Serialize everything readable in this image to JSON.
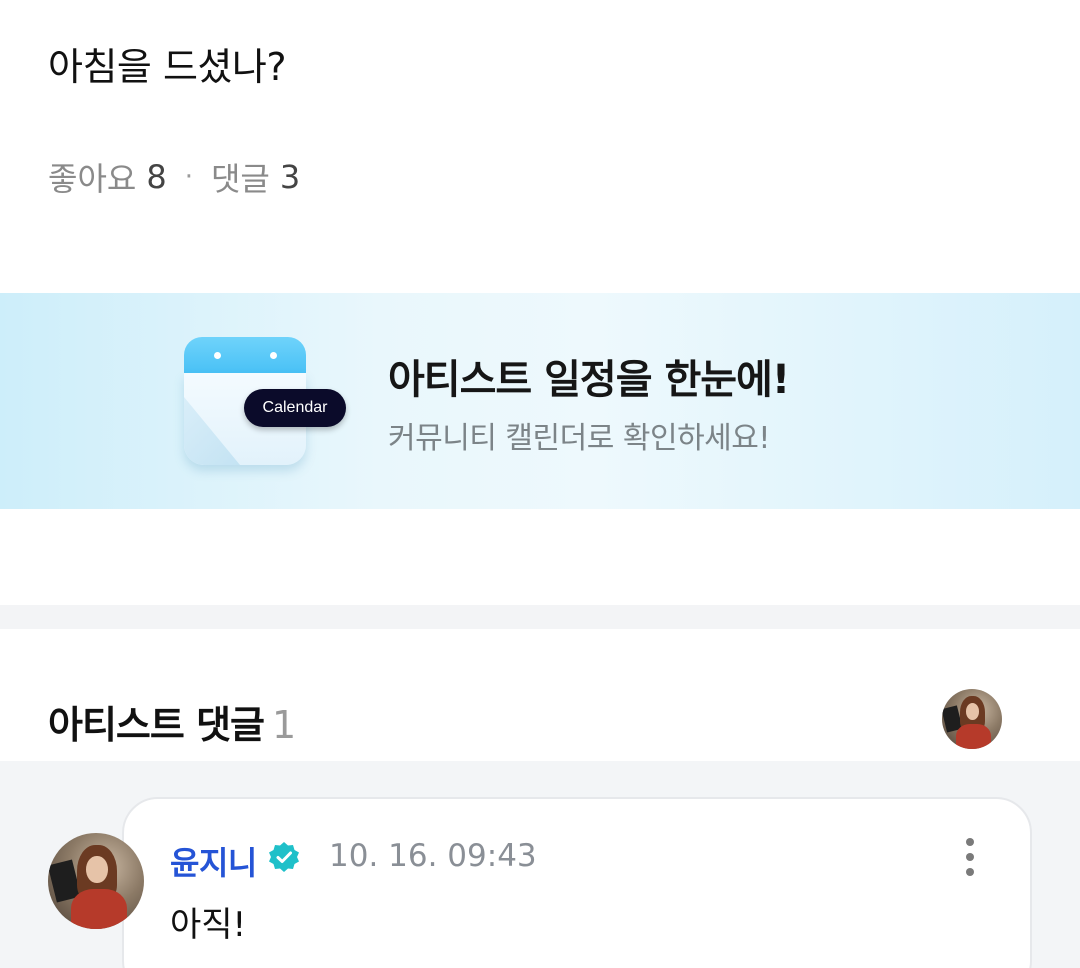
{
  "post": {
    "title": "아침을 드셨나?",
    "likes_label": "좋아요",
    "likes_count": "8",
    "separator": "·",
    "comments_label": "댓글",
    "comments_count": "3"
  },
  "banner": {
    "calendar_label": "Calendar",
    "title": "아티스트 일정을 한눈에!",
    "subtitle": "커뮤니티 캘린더로 확인하세요!"
  },
  "artist_comments": {
    "title": "아티스트 댓글",
    "count": "1"
  },
  "comment": {
    "author": "윤지니",
    "timestamp": "10. 16. 09:43",
    "text": "아직!"
  },
  "icons": {
    "verified": "verified-badge-icon",
    "more": "more-vertical-icon",
    "calendar": "calendar-icon"
  },
  "colors": {
    "author_name": "#2554d6",
    "verified_badge": "#1fc0c9",
    "banner_bg": "#e6f6fc",
    "calendar_pill": "#0b0b2a"
  }
}
